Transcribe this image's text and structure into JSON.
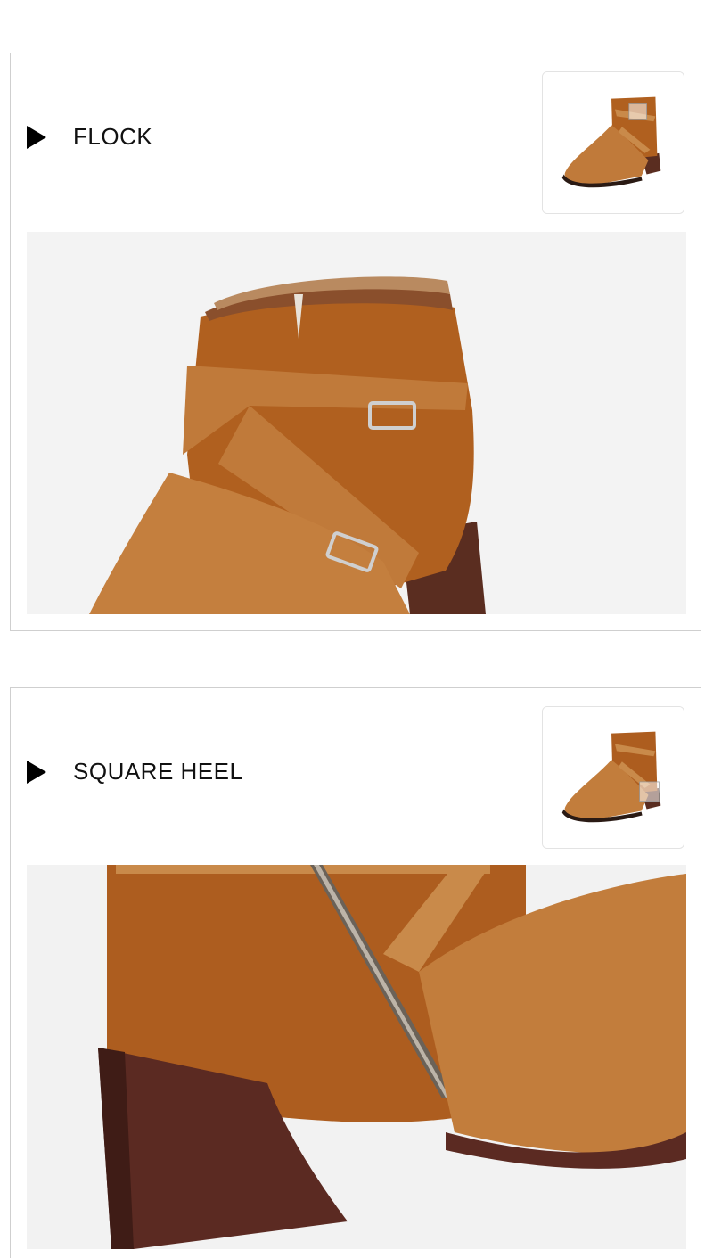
{
  "sections": [
    {
      "label": "FLOCK",
      "thumbnail_icon": "ankle-boot-thumbnail",
      "photo_icon": "boot-buckle-closeup",
      "colors": {
        "suede": "#b0601f",
        "leather": "#c07a3a",
        "heel": "#5a2d20"
      }
    },
    {
      "label": "SQUARE HEEL",
      "thumbnail_icon": "ankle-boot-thumbnail",
      "photo_icon": "boot-heel-closeup",
      "colors": {
        "suede": "#ad5d1f",
        "leather": "#c27d3c",
        "heel": "#5b2a22"
      }
    }
  ]
}
